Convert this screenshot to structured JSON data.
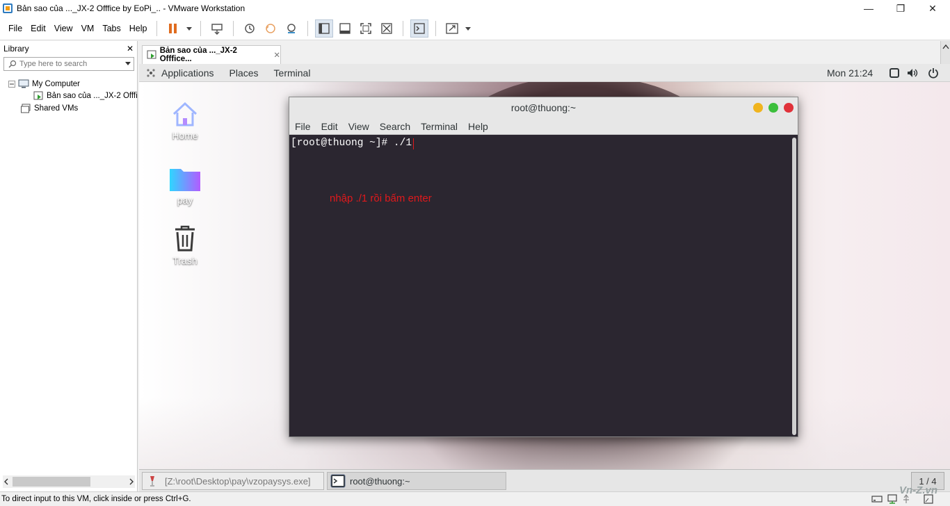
{
  "window": {
    "title": "Bản sao của ..._JX-2 Offfice by EoPi_.. - VMware Workstation",
    "minimize_glyph": "—",
    "maximize_glyph": "❐",
    "close_glyph": "✕"
  },
  "menu": {
    "items": [
      "File",
      "Edit",
      "View",
      "VM",
      "Tabs",
      "Help"
    ]
  },
  "library": {
    "title": "Library",
    "close_glyph": "✕",
    "search_placeholder": "Type here to search",
    "tree": {
      "root": "My Computer",
      "vm": "Bản sao của ..._JX-2 Offfi",
      "shared": "Shared VMs"
    }
  },
  "vm_tab": {
    "label": "Bản sao của ..._JX-2 Offfice...",
    "close_glyph": "✕"
  },
  "gnome_panel": {
    "applications": "Applications",
    "places": "Places",
    "terminal": "Terminal",
    "clock": "Mon 21:24"
  },
  "desktop_icons": [
    {
      "label": "Home",
      "icon": "home-icon"
    },
    {
      "label": "pay",
      "icon": "folder-icon"
    },
    {
      "label": "Trash",
      "icon": "trash-icon"
    }
  ],
  "terminal": {
    "title": "root@thuong:~",
    "menu": [
      "File",
      "Edit",
      "View",
      "Search",
      "Terminal",
      "Help"
    ],
    "prompt": "[root@thuong ~]# ./1",
    "annotation": "nhập ./1 rồi bấm enter",
    "close_color": "#e0323a",
    "min_color": "#f0b41e",
    "max_color": "#3cbf3c"
  },
  "taskbar": {
    "item1": "[Z:\\root\\Desktop\\pay\\vzopaysys.exe]",
    "item2": "root@thuong:~",
    "pager": "1 / 4"
  },
  "statusbar": {
    "text": "To direct input to this VM, click inside or press Ctrl+G."
  },
  "watermark": "Vn-Z.vn"
}
